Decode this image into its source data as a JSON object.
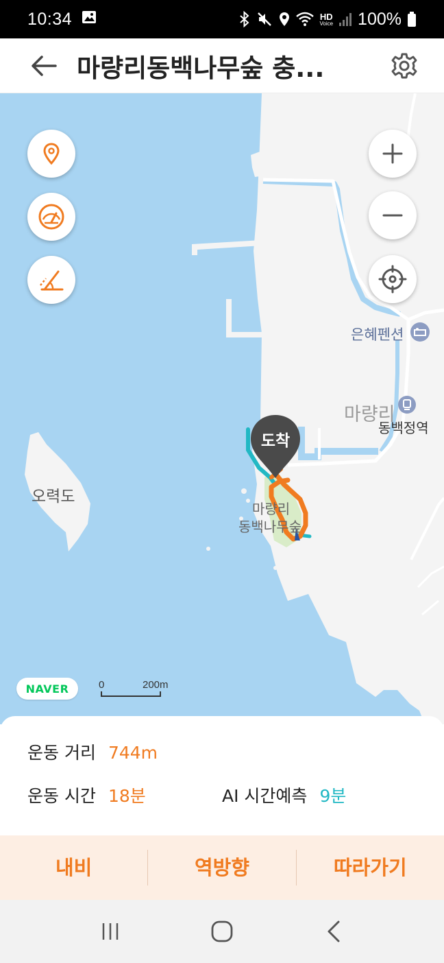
{
  "status_bar": {
    "time": "10:34",
    "battery": "100%",
    "hd_label": "HD",
    "voice_label": "Voice"
  },
  "header": {
    "title": "마량리동백나무숲 충..."
  },
  "map": {
    "labels": {
      "island": "오력도",
      "pension": "은혜펜션",
      "village": "마량리",
      "station": "동백정역",
      "forest_line1": "마량리",
      "forest_line2": "동백나무숲"
    },
    "arrive_marker": "도착",
    "logo": "NAVER",
    "scale": {
      "start": "0",
      "end": "200m"
    },
    "colors": {
      "water": "#a8d4f2",
      "land": "#f4f4f4",
      "route": "#f07b20",
      "route_ai": "#22b8c4",
      "accent": "#f07b20"
    }
  },
  "info": {
    "distance_label": "운동 거리",
    "distance_value": "744m",
    "time_label": "운동 시간",
    "time_value": "18분",
    "ai_label": "AI 시간예측",
    "ai_value": "9분"
  },
  "actions": {
    "navi": "내비",
    "reverse": "역방향",
    "follow": "따라가기"
  },
  "icons": [
    "back-arrow-icon",
    "gear-icon",
    "location-pin-icon",
    "speedometer-icon",
    "slope-icon",
    "zoom-in-icon",
    "zoom-out-icon",
    "crosshair-icon",
    "hotel-icon",
    "train-icon"
  ]
}
